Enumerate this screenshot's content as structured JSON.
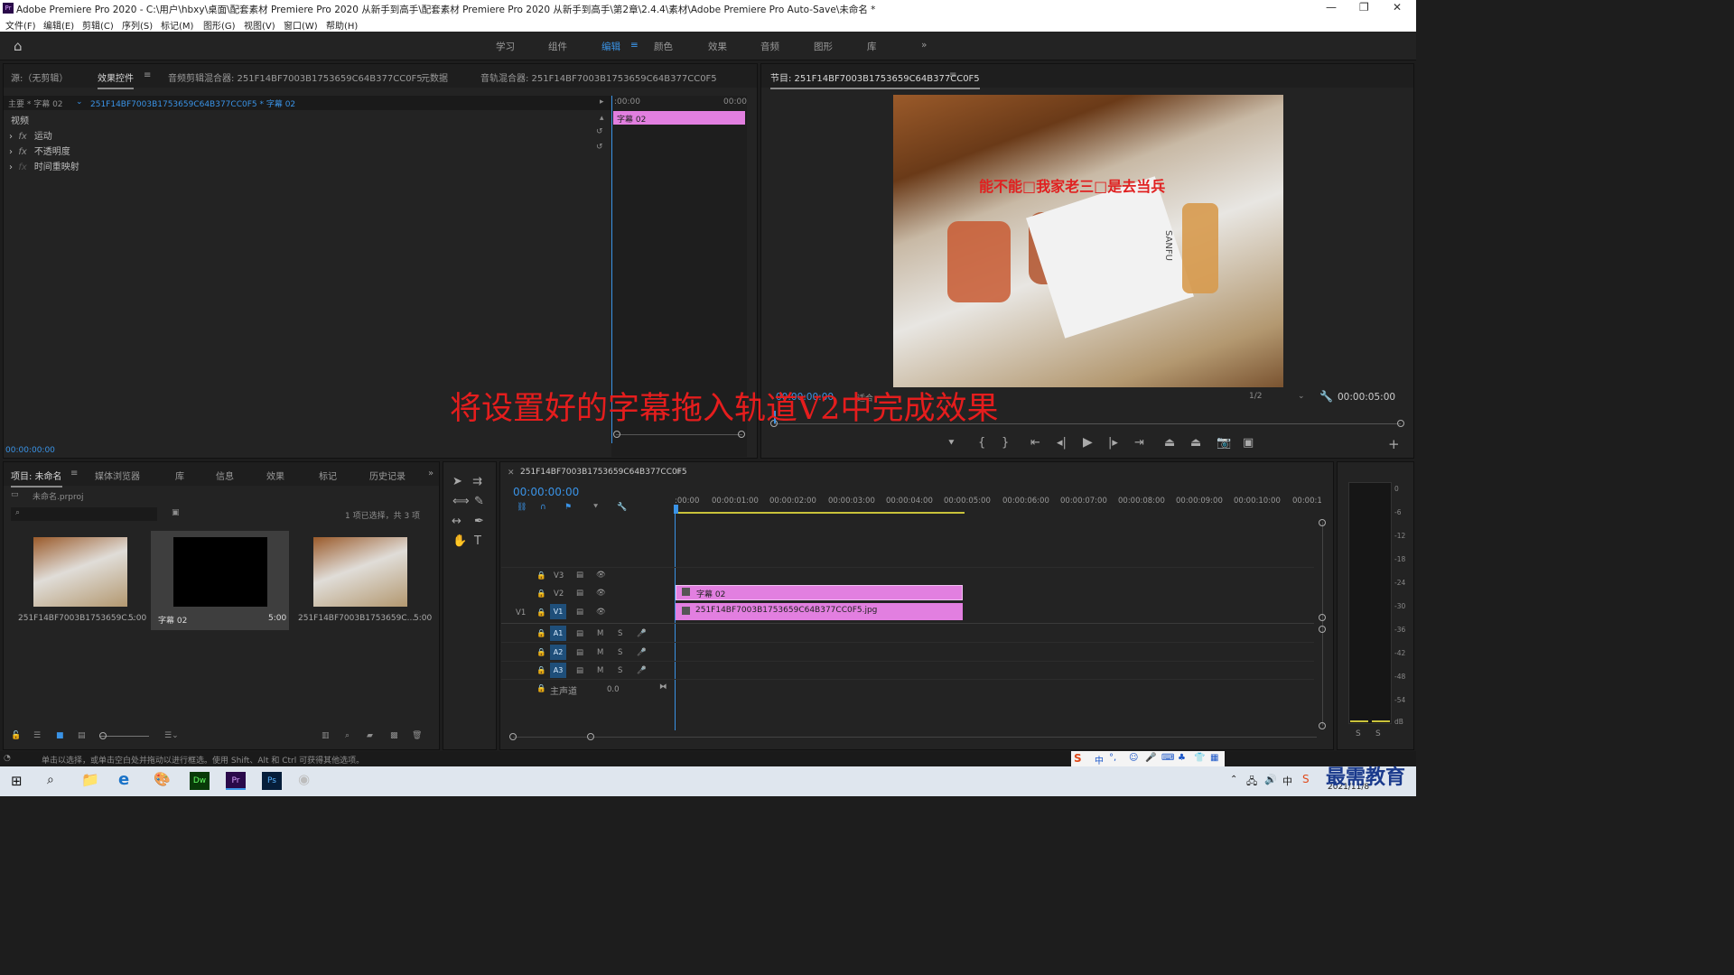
{
  "window": {
    "title": "Adobe Premiere Pro 2020 - C:\\用户\\hbxy\\桌面\\配套素材 Premiere Pro 2020 从新手到高手\\配套素材 Premiere Pro 2020 从新手到高手\\第2章\\2.4.4\\素材\\Adobe Premiere Pro Auto-Save\\未命名 *",
    "app_icon": "Pr"
  },
  "menu": [
    "文件(F)",
    "编辑(E)",
    "剪辑(C)",
    "序列(S)",
    "标记(M)",
    "图形(G)",
    "视图(V)",
    "窗口(W)",
    "帮助(H)"
  ],
  "workspaces": [
    "学习",
    "组件",
    "编辑",
    "颜色",
    "效果",
    "音频",
    "图形",
    "库"
  ],
  "active_workspace": "编辑",
  "source_tabs": [
    "源:（无剪辑）",
    "效果控件",
    "音频剪辑混合器: 251F14BF7003B1753659C64B377CC0F5",
    "元数据",
    "音轨混合器: 251F14BF7003B1753659C64B377CC0F5"
  ],
  "effect_controls": {
    "master": "主要 * 字幕 02",
    "sequence": "251F14BF7003B1753659C64B377CC0F5 * 字幕 02",
    "video_label": "视频",
    "effects": [
      "运动",
      "不透明度",
      "时间重映射"
    ],
    "time_start": ":00:00",
    "time_end": "00:00",
    "clip_label": "字幕 02",
    "timecode": "00:00:00:00"
  },
  "program": {
    "title": "节目: 251F14BF7003B1753659C64B377CC0F5",
    "subtitle_text": "能不能□我家老三□是去当兵",
    "timecode": "00:00:00:00",
    "fit": "适合",
    "resolution": "1/2",
    "duration": "00:00:05:00",
    "brand_on_card": "SANFU"
  },
  "overlay_caption": "将设置好的字幕拖入轨道V2中完成效果",
  "project": {
    "tabs": [
      "项目: 未命名",
      "媒体浏览器",
      "库",
      "信息",
      "效果",
      "标记",
      "历史记录"
    ],
    "file": "未命名.prproj",
    "selection": "1 项已选择，共 3 项",
    "search_placeholder": "",
    "items": [
      {
        "name": "251F14BF7003B1753659C...",
        "duration": "5:00"
      },
      {
        "name": "字幕 02",
        "duration": "5:00"
      },
      {
        "name": "251F14BF7003B1753659C...",
        "duration": "5:00"
      }
    ]
  },
  "timeline": {
    "title": "251F14BF7003B1753659C64B377CC0F5",
    "timecode": "00:00:00:00",
    "ticks": [
      ":00:00",
      "00:00:01:00",
      "00:00:02:00",
      "00:00:03:00",
      "00:00:04:00",
      "00:00:05:00",
      "00:00:06:00",
      "00:00:07:00",
      "00:00:08:00",
      "00:00:09:00",
      "00:00:10:00",
      "00:00:1"
    ],
    "video_tracks": [
      "V3",
      "V2",
      "V1"
    ],
    "source_patch": "V1",
    "audio_tracks": [
      "A1",
      "A2",
      "A3"
    ],
    "master": "主声道",
    "master_value": "0.0",
    "clips": [
      {
        "track": "V2",
        "label": "字幕 02"
      },
      {
        "track": "V1",
        "label": "251F14BF7003B1753659C64B377CC0F5.jpg"
      }
    ],
    "mute": "M",
    "solo": "S"
  },
  "meter": {
    "ticks": [
      "0",
      "-6",
      "-12",
      "-18",
      "-24",
      "-30",
      "-36",
      "-42",
      "-48",
      "-54",
      "dB"
    ],
    "solo": [
      "S",
      "S"
    ]
  },
  "status": "单击以选择，或单击空白处并拖动以进行框选。使用 Shift、Alt 和 Ctrl 可获得其他选项。",
  "taskbar": {
    "date": "2021/11/8",
    "watermark": "最需教育",
    "ime": [
      "中",
      "°,"
    ]
  }
}
